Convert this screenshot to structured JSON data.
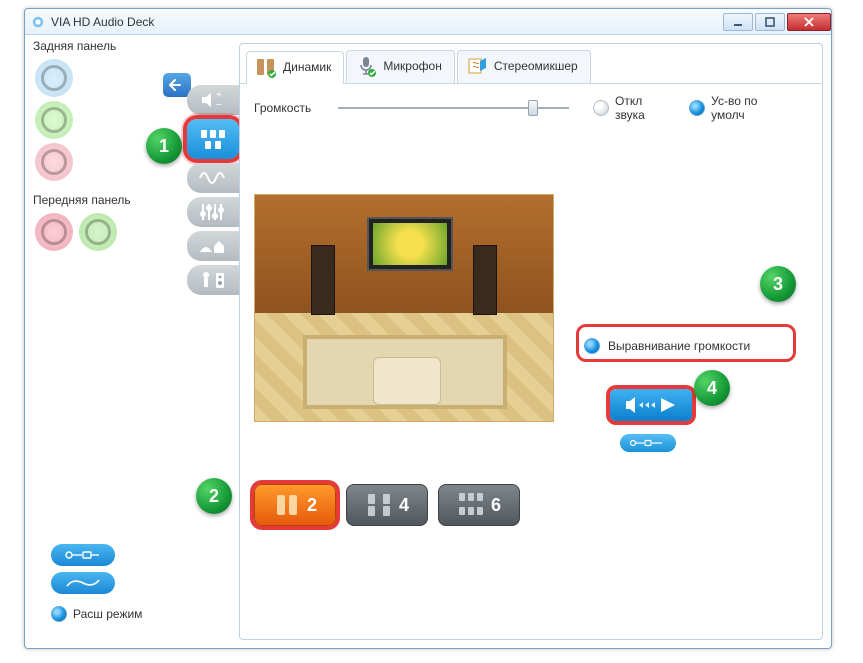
{
  "window": {
    "title": "VIA HD Audio Deck"
  },
  "left": {
    "rear_panel_label": "Задняя панель",
    "front_panel_label": "Передняя панель",
    "adv_mode_label": "Расш режим"
  },
  "tabs": {
    "speaker": "Динамик",
    "microphone": "Микрофон",
    "stereomixer": "Стереомикшер"
  },
  "volume": {
    "label": "Громкость",
    "mute_label": "Откл звука",
    "default_label": "Ус-во по умолч"
  },
  "leveling": {
    "label": "Выравнивание громкости"
  },
  "speaker_counts": {
    "c2": "2",
    "c4": "4",
    "c6": "6"
  },
  "annotations": {
    "s1": "1",
    "s2": "2",
    "s3": "3",
    "s4": "4"
  }
}
